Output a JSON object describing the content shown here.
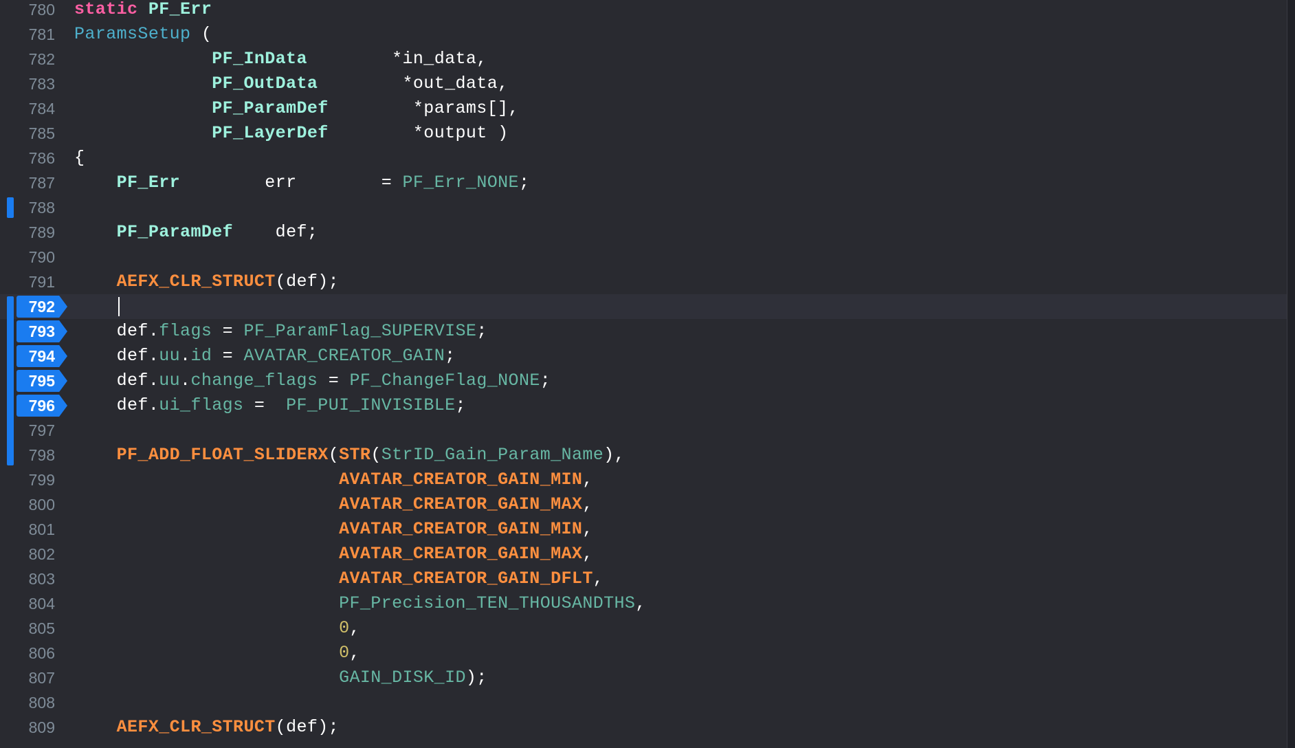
{
  "editor": {
    "theme_colors": {
      "background": "#292a30",
      "line_number": "#7f8c98",
      "breakpoint": "#1a7cf0",
      "keyword": "#fc5fa3",
      "function_decl": "#4eb0cc",
      "type": "#9ef1dd",
      "macro": "#fd8f3f",
      "identifier": "#67b7a4",
      "number": "#d0bf69",
      "plain": "#ffffff"
    },
    "current_line": 792,
    "lines": [
      {
        "num": "780",
        "tokens": [
          {
            "t": "static",
            "k": "keyword"
          },
          {
            "t": " PF_Err",
            "k": "type"
          }
        ]
      },
      {
        "num": "781",
        "tokens": [
          {
            "t": "ParamsSetup",
            "k": "function_decl"
          },
          {
            "t": " (",
            "k": "plain"
          }
        ]
      },
      {
        "num": "782",
        "tokens": [
          {
            "t": "             ",
            "k": "plain"
          },
          {
            "t": "PF_InData",
            "k": "type"
          },
          {
            "t": "        *in_data,",
            "k": "plain"
          }
        ]
      },
      {
        "num": "783",
        "tokens": [
          {
            "t": "             ",
            "k": "plain"
          },
          {
            "t": "PF_OutData",
            "k": "type"
          },
          {
            "t": "        *out_data,",
            "k": "plain"
          }
        ]
      },
      {
        "num": "784",
        "tokens": [
          {
            "t": "             ",
            "k": "plain"
          },
          {
            "t": "PF_ParamDef",
            "k": "type"
          },
          {
            "t": "        *params[],",
            "k": "plain"
          }
        ]
      },
      {
        "num": "785",
        "tokens": [
          {
            "t": "             ",
            "k": "plain"
          },
          {
            "t": "PF_LayerDef",
            "k": "type"
          },
          {
            "t": "        *output )",
            "k": "plain"
          }
        ]
      },
      {
        "num": "786",
        "tokens": [
          {
            "t": "{",
            "k": "plain"
          }
        ]
      },
      {
        "num": "787",
        "tokens": [
          {
            "t": "    ",
            "k": "plain"
          },
          {
            "t": "PF_Err",
            "k": "type"
          },
          {
            "t": "        err        = ",
            "k": "plain"
          },
          {
            "t": "PF_Err_NONE",
            "k": "identifier"
          },
          {
            "t": ";",
            "k": "plain"
          }
        ]
      },
      {
        "num": "788",
        "tokens": []
      },
      {
        "num": "789",
        "tokens": [
          {
            "t": "    ",
            "k": "plain"
          },
          {
            "t": "PF_ParamDef",
            "k": "type"
          },
          {
            "t": "    def;",
            "k": "plain"
          }
        ]
      },
      {
        "num": "790",
        "tokens": []
      },
      {
        "num": "791",
        "tokens": [
          {
            "t": "    ",
            "k": "plain"
          },
          {
            "t": "AEFX_CLR_STRUCT",
            "k": "macro"
          },
          {
            "t": "(def);",
            "k": "plain"
          }
        ]
      },
      {
        "num": "792",
        "tokens": []
      },
      {
        "num": "793",
        "tokens": [
          {
            "t": "    def.",
            "k": "plain"
          },
          {
            "t": "flags",
            "k": "identifier"
          },
          {
            "t": " = ",
            "k": "plain"
          },
          {
            "t": "PF_ParamFlag_SUPERVISE",
            "k": "identifier"
          },
          {
            "t": ";",
            "k": "plain"
          }
        ]
      },
      {
        "num": "794",
        "tokens": [
          {
            "t": "    def.",
            "k": "plain"
          },
          {
            "t": "uu",
            "k": "identifier"
          },
          {
            "t": ".",
            "k": "plain"
          },
          {
            "t": "id",
            "k": "identifier"
          },
          {
            "t": " = ",
            "k": "plain"
          },
          {
            "t": "AVATAR_CREATOR_GAIN",
            "k": "identifier"
          },
          {
            "t": ";",
            "k": "plain"
          }
        ]
      },
      {
        "num": "795",
        "tokens": [
          {
            "t": "    def.",
            "k": "plain"
          },
          {
            "t": "uu",
            "k": "identifier"
          },
          {
            "t": ".",
            "k": "plain"
          },
          {
            "t": "change_flags",
            "k": "identifier"
          },
          {
            "t": " = ",
            "k": "plain"
          },
          {
            "t": "PF_ChangeFlag_NONE",
            "k": "identifier"
          },
          {
            "t": ";",
            "k": "plain"
          }
        ]
      },
      {
        "num": "796",
        "tokens": [
          {
            "t": "    def.",
            "k": "plain"
          },
          {
            "t": "ui_flags",
            "k": "identifier"
          },
          {
            "t": " =  ",
            "k": "plain"
          },
          {
            "t": "PF_PUI_INVISIBLE",
            "k": "identifier"
          },
          {
            "t": ";",
            "k": "plain"
          }
        ]
      },
      {
        "num": "797",
        "tokens": []
      },
      {
        "num": "798",
        "tokens": [
          {
            "t": "    ",
            "k": "plain"
          },
          {
            "t": "PF_ADD_FLOAT_SLIDERX",
            "k": "macro"
          },
          {
            "t": "(",
            "k": "plain"
          },
          {
            "t": "STR",
            "k": "macro"
          },
          {
            "t": "(",
            "k": "plain"
          },
          {
            "t": "StrID_Gain_Param_Name",
            "k": "identifier"
          },
          {
            "t": "),",
            "k": "plain"
          }
        ]
      },
      {
        "num": "799",
        "tokens": [
          {
            "t": "                         ",
            "k": "plain"
          },
          {
            "t": "AVATAR_CREATOR_GAIN_MIN",
            "k": "macro"
          },
          {
            "t": ",",
            "k": "plain"
          }
        ]
      },
      {
        "num": "800",
        "tokens": [
          {
            "t": "                         ",
            "k": "plain"
          },
          {
            "t": "AVATAR_CREATOR_GAIN_MAX",
            "k": "macro"
          },
          {
            "t": ",",
            "k": "plain"
          }
        ]
      },
      {
        "num": "801",
        "tokens": [
          {
            "t": "                         ",
            "k": "plain"
          },
          {
            "t": "AVATAR_CREATOR_GAIN_MIN",
            "k": "macro"
          },
          {
            "t": ",",
            "k": "plain"
          }
        ]
      },
      {
        "num": "802",
        "tokens": [
          {
            "t": "                         ",
            "k": "plain"
          },
          {
            "t": "AVATAR_CREATOR_GAIN_MAX",
            "k": "macro"
          },
          {
            "t": ",",
            "k": "plain"
          }
        ]
      },
      {
        "num": "803",
        "tokens": [
          {
            "t": "                         ",
            "k": "plain"
          },
          {
            "t": "AVATAR_CREATOR_GAIN_DFLT",
            "k": "macro"
          },
          {
            "t": ",",
            "k": "plain"
          }
        ]
      },
      {
        "num": "804",
        "tokens": [
          {
            "t": "                         ",
            "k": "plain"
          },
          {
            "t": "PF_Precision_TEN_THOUSANDTHS",
            "k": "identifier"
          },
          {
            "t": ",",
            "k": "plain"
          }
        ]
      },
      {
        "num": "805",
        "tokens": [
          {
            "t": "                         ",
            "k": "plain"
          },
          {
            "t": "0",
            "k": "number"
          },
          {
            "t": ",",
            "k": "plain"
          }
        ]
      },
      {
        "num": "806",
        "tokens": [
          {
            "t": "                         ",
            "k": "plain"
          },
          {
            "t": "0",
            "k": "number"
          },
          {
            "t": ",",
            "k": "plain"
          }
        ]
      },
      {
        "num": "807",
        "tokens": [
          {
            "t": "                         ",
            "k": "plain"
          },
          {
            "t": "GAIN_DISK_ID",
            "k": "identifier"
          },
          {
            "t": ");",
            "k": "plain"
          }
        ]
      },
      {
        "num": "808",
        "tokens": []
      },
      {
        "num": "809",
        "tokens": [
          {
            "t": "    ",
            "k": "plain"
          },
          {
            "t": "AEFX_CLR_STRUCT",
            "k": "macro"
          },
          {
            "t": "(def);",
            "k": "plain"
          }
        ]
      }
    ],
    "breakpoint_lines": [
      "792",
      "793",
      "794",
      "795",
      "796"
    ],
    "change_bar_groups": [
      [
        "788"
      ],
      [
        "792",
        "793",
        "794",
        "795",
        "796",
        "797",
        "798"
      ]
    ]
  }
}
